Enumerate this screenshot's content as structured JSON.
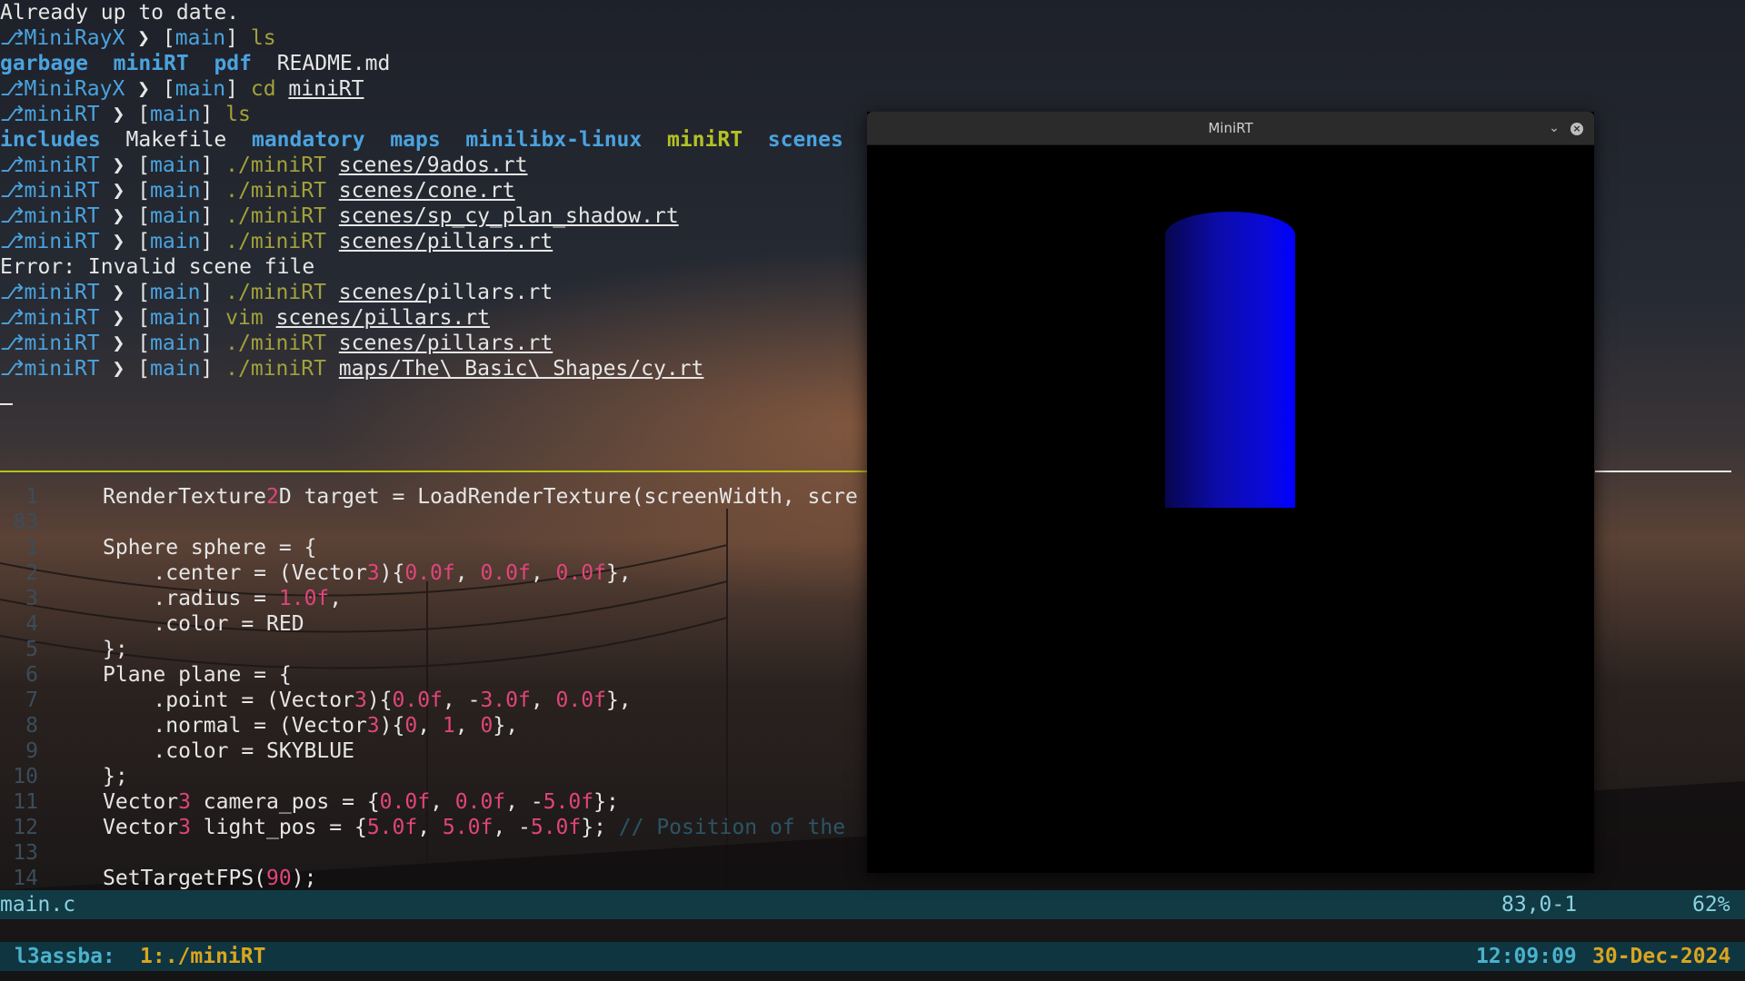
{
  "terminal": {
    "prompt_symbol": "⎇",
    "prompt_arrow": "❯",
    "lines": [
      {
        "type": "text",
        "text": "Already up to date."
      },
      {
        "type": "prompt",
        "dir": "MiniRayX",
        "branch": "[main]",
        "exe": "ls",
        "arg": "",
        "arg2": ""
      },
      {
        "type": "ls1",
        "items": [
          "garbage",
          "miniRT",
          "pdf",
          "README.md"
        ]
      },
      {
        "type": "prompt",
        "dir": "MiniRayX",
        "branch": "[main]",
        "exe": "cd",
        "arg": "miniRT",
        "arg2": ""
      },
      {
        "type": "prompt",
        "dir": "miniRT",
        "branch": "[main]",
        "exe": "ls",
        "arg": "",
        "arg2": ""
      },
      {
        "type": "ls2",
        "items": [
          "includes",
          "Makefile",
          "mandatory",
          "maps",
          "minilibx-linux",
          "miniRT",
          "scenes"
        ]
      },
      {
        "type": "prompt",
        "dir": "miniRT",
        "branch": "[main]",
        "exe": "./miniRT",
        "arg": "scenes/9ados.rt",
        "arg2": ""
      },
      {
        "type": "prompt",
        "dir": "miniRT",
        "branch": "[main]",
        "exe": "./miniRT",
        "arg": "scenes/cone.rt",
        "arg2": ""
      },
      {
        "type": "prompt",
        "dir": "miniRT",
        "branch": "[main]",
        "exe": "./miniRT",
        "arg": "scenes/sp_cy_plan_shadow.rt",
        "arg2": ""
      },
      {
        "type": "prompt",
        "dir": "miniRT",
        "branch": "[main]",
        "exe": "./miniRT",
        "arg": "scenes/pillars.rt",
        "arg2": ""
      },
      {
        "type": "text",
        "text": "Error: Invalid scene file"
      },
      {
        "type": "prompt",
        "dir": "miniRT",
        "branch": "[main]",
        "exe": "./miniRT",
        "arg": "scenes/",
        "arg2": "pillars.rt"
      },
      {
        "type": "prompt",
        "dir": "miniRT",
        "branch": "[main]",
        "exe": "vim",
        "arg": "scenes/pillars.rt",
        "arg2": ""
      },
      {
        "type": "prompt",
        "dir": "miniRT",
        "branch": "[main]",
        "exe": "./miniRT",
        "arg": "scenes/pillars.rt",
        "arg2": ""
      },
      {
        "type": "prompt",
        "dir": "miniRT",
        "branch": "[main]",
        "exe": "./miniRT",
        "arg": "maps/The\\ Basic\\ Shapes/cy.rt",
        "arg2": ""
      }
    ]
  },
  "editor": {
    "lines": [
      {
        "ln": "1",
        "code": "RenderTexture2D target = LoadRenderTexture(screenWidth, scre"
      },
      {
        "ln": "83",
        "code": ""
      },
      {
        "ln": "1",
        "code": "Sphere sphere = {"
      },
      {
        "ln": "2",
        "code": "    .center = (Vector3){0.0f, 0.0f, 0.0f},"
      },
      {
        "ln": "3",
        "code": "    .radius = 1.0f,"
      },
      {
        "ln": "4",
        "code": "    .color = RED"
      },
      {
        "ln": "5",
        "code": "};"
      },
      {
        "ln": "6",
        "code": "Plane plane = {"
      },
      {
        "ln": "7",
        "code": "    .point = (Vector3){0.0f, -3.0f, 0.0f},"
      },
      {
        "ln": "8",
        "code": "    .normal = (Vector3){0, 1, 0},"
      },
      {
        "ln": "9",
        "code": "    .color = SKYBLUE"
      },
      {
        "ln": "10",
        "code": "};"
      },
      {
        "ln": "11",
        "code": "Vector3 camera_pos = {0.0f, 0.0f, -5.0f};"
      },
      {
        "ln": "12",
        "code": "Vector3 light_pos = {5.0f, 5.0f, -5.0f}; // Position of the"
      },
      {
        "ln": "13",
        "code": ""
      },
      {
        "ln": "14",
        "code": "SetTargetFPS(90);"
      }
    ],
    "status": {
      "filename": "main.c",
      "position": "83,0-1",
      "percent": "62%"
    }
  },
  "tmux": {
    "session": "l3assba:",
    "window": "1:./miniRT",
    "time": "12:09:09",
    "date": "30-Dec-2024"
  },
  "minirt_window": {
    "title": "MiniRT",
    "minimize_icon": "chevron-down-icon",
    "close_icon": "close-icon",
    "object_color": "#0000ff"
  },
  "colors": {
    "dir": "#4aa3df",
    "number": "#e0457b",
    "status_bg": "#123a44",
    "accent_green": "#b4c224"
  }
}
